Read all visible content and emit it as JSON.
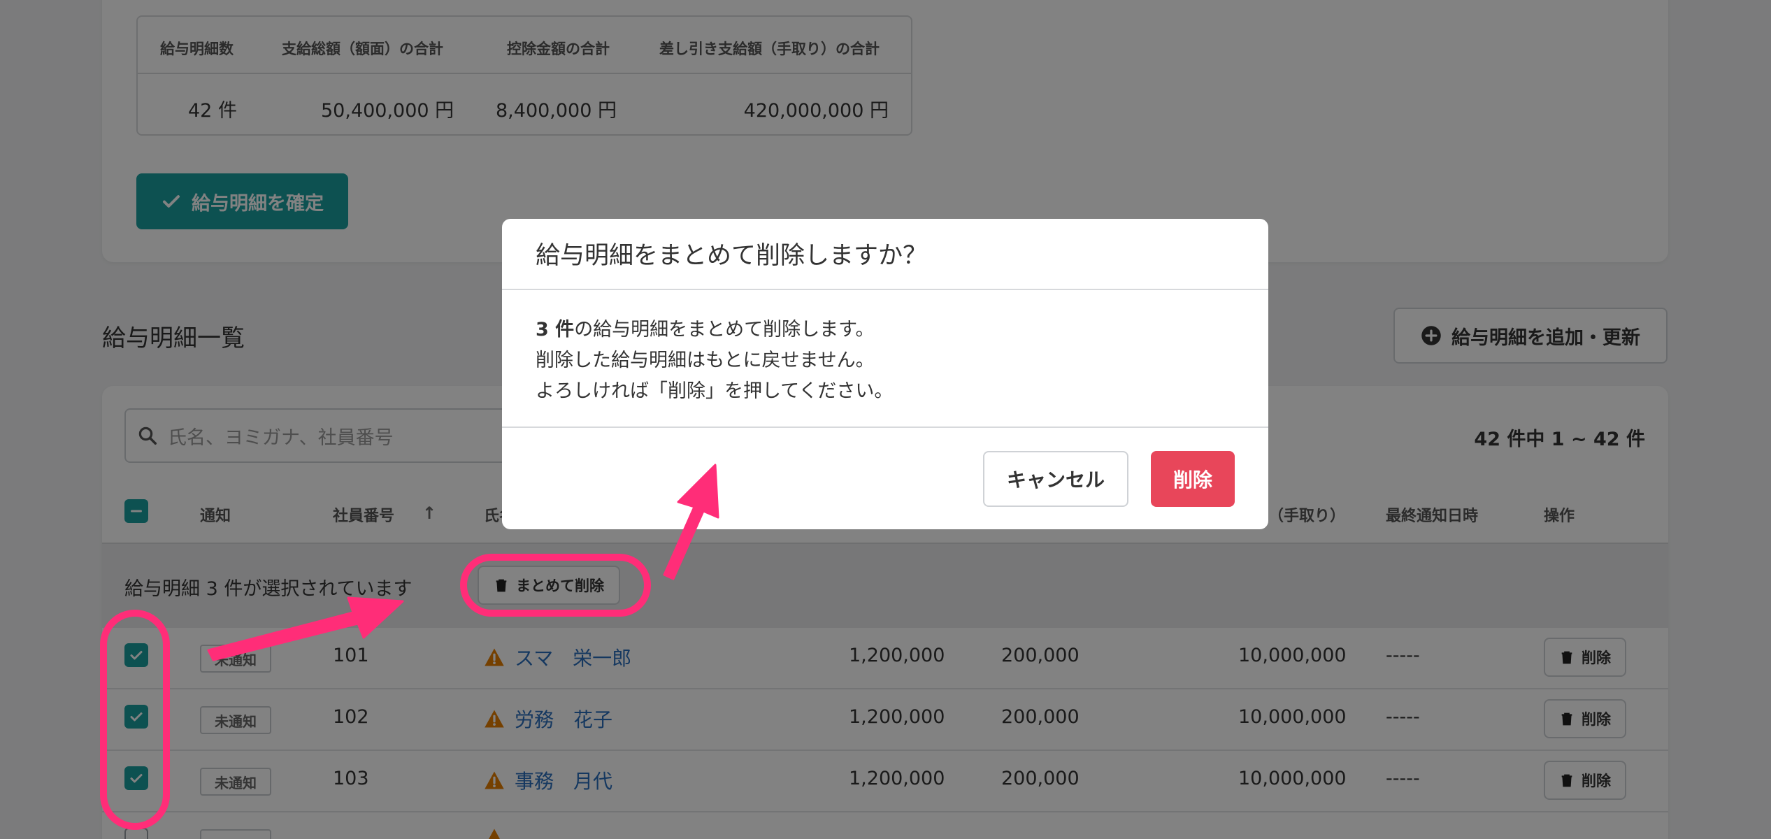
{
  "summary": {
    "headers": [
      "給与明細数",
      "支給総額（額面）の合計",
      "控除金額の合計",
      "差し引き支給額（手取り）の合計"
    ],
    "values": [
      "42 件",
      "50,400,000 円",
      "8,400,000 円",
      "420,000,000 円"
    ]
  },
  "confirm_button": "給与明細を確定",
  "section_title": "給与明細一覧",
  "add_update_button": "給与明細を追加・更新",
  "search": {
    "placeholder": "氏名、ヨミガナ、社員番号"
  },
  "count": {
    "prefix": "42 件中 ",
    "range": "1 ~ 42",
    "suffix": " 件"
  },
  "table": {
    "headers": {
      "notify": "通知",
      "employee_no": "社員番号",
      "name_partial": "氏名",
      "net_partial": "（手取り）",
      "last_notified": "最終通知日時",
      "actions": "操作"
    },
    "sort_arrow": "↑"
  },
  "selection": {
    "text": "給与明細 3 件が選択されています",
    "bulk_delete": "まとめて削除"
  },
  "rows": [
    {
      "status": "未通知",
      "employee_no": "101",
      "name": "スマ　栄一郎",
      "gross": "1,200,000",
      "deduction": "200,000",
      "net": "10,000,000",
      "last_notified": "-----",
      "delete": "削除"
    },
    {
      "status": "未通知",
      "employee_no": "102",
      "name": "労務　花子",
      "gross": "1,200,000",
      "deduction": "200,000",
      "net": "10,000,000",
      "last_notified": "-----",
      "delete": "削除"
    },
    {
      "status": "未通知",
      "employee_no": "103",
      "name": "事務　月代",
      "gross": "1,200,000",
      "deduction": "200,000",
      "net": "10,000,000",
      "last_notified": "-----",
      "delete": "削除"
    }
  ],
  "modal": {
    "title": "給与明細をまとめて削除しますか？",
    "count_bold": "3 件",
    "line1_rest": "の給与明細をまとめて削除します。",
    "line2": "削除した給与明細はもとに戻せません。",
    "line3": "よろしければ「削除」を押してください。",
    "cancel": "キャンセル",
    "delete": "削除"
  },
  "colors": {
    "accent": "#1aa0a0",
    "danger": "#e8465a",
    "annotation": "#ff2d78",
    "link": "#2a6ebd",
    "warning": "#e67e00"
  }
}
